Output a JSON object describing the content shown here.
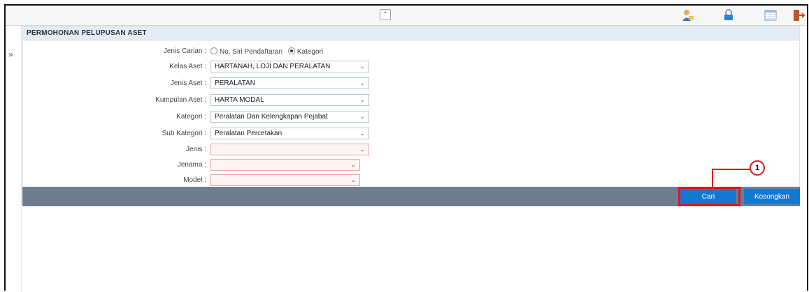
{
  "panel": {
    "title": "PERMOHONAN PELUPUSAN ASET",
    "search_type": {
      "label": "Jenis Carian :",
      "options": [
        "No. Siri Pendaftaran",
        "Kategori"
      ],
      "selected": "Kategori"
    },
    "fields": [
      {
        "label": "Kelas Aset :",
        "value": "HARTANAH, LOJI DAN PERALATAN"
      },
      {
        "label": "Jenis Aset :",
        "value": "PERALATAN"
      },
      {
        "label": "Kumpulan Aset :",
        "value": "HARTA MODAL"
      },
      {
        "label": "Kategori :",
        "value": "Peralatan Dan Kelengkapan Pejabat"
      },
      {
        "label": "Sub Kategori :",
        "value": "Peralatan Percetakan"
      },
      {
        "label": "Jenis :",
        "value": ""
      },
      {
        "label": "Jenama :",
        "value": ""
      },
      {
        "label": "Model :",
        "value": ""
      }
    ]
  },
  "actions": {
    "search_label": "Cari",
    "clear_label": "Kosongkan"
  },
  "callout": {
    "number": "1"
  },
  "icons": {
    "collapse": "double-chevron-up-icon",
    "sidebar_toggle": "double-chevron-right-icon",
    "user": "user-icon",
    "lock": "lock-icon",
    "calendar": "calendar-icon",
    "logout": "logout-icon"
  },
  "colors": {
    "accent": "#1478d2",
    "action_bar": "#6e7e8f",
    "highlight": "#e4131d",
    "panel_header": "#e4ecf5"
  }
}
